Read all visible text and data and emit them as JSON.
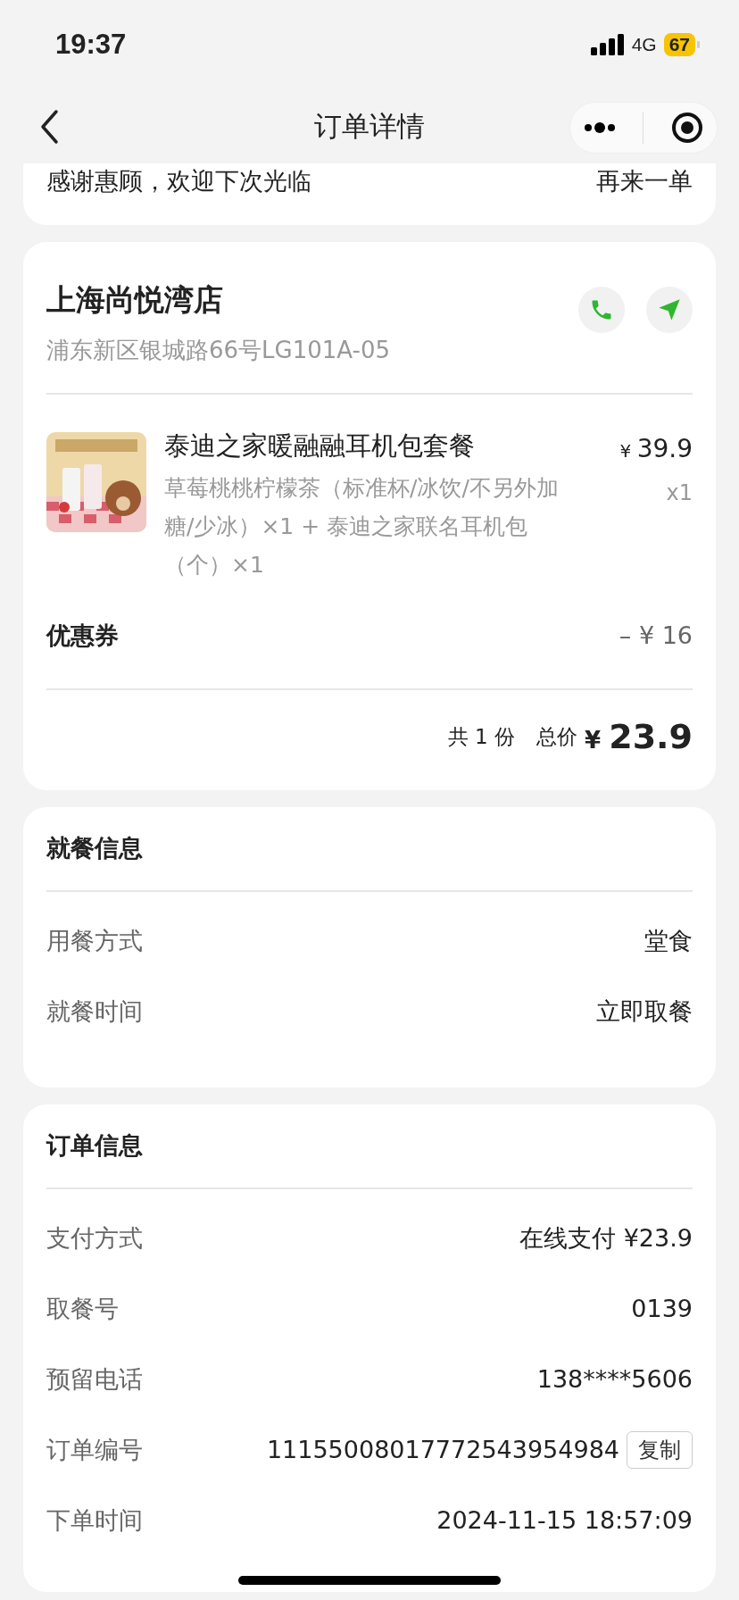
{
  "status_bar": {
    "time": "19:37",
    "network": "4G",
    "battery": "67"
  },
  "nav": {
    "title": "订单详情"
  },
  "notice": {
    "message": "感谢惠顾，欢迎下次光临",
    "action": "再来一单"
  },
  "store": {
    "name": "上海尚悦湾店",
    "address": "浦东新区银城路66号LG101A-05"
  },
  "product": {
    "kind": "picture",
    "name": "泰迪之家暖融融耳机包套餐",
    "description": "草莓桃桃柠檬茶（标准杯/冰饮/不另外加糖/少冰）×1 + 泰迪之家联名耳机包（个）×1",
    "currency": "¥",
    "price": "39.9",
    "quantity": "x1"
  },
  "coupon": {
    "label": "优惠券",
    "value": "– ¥ 16"
  },
  "total": {
    "count": "共 1 份",
    "label": "总价",
    "currency": "¥",
    "amount": "23.9"
  },
  "dining": {
    "title": "就餐信息",
    "rows": [
      {
        "label": "用餐方式",
        "value": "堂食"
      },
      {
        "label": "就餐时间",
        "value": "立即取餐"
      }
    ]
  },
  "order": {
    "title": "订单信息",
    "rows": [
      {
        "label": "支付方式",
        "value": "在线支付 ¥23.9"
      },
      {
        "label": "取餐号",
        "value": "0139"
      },
      {
        "label": "预留电话",
        "value": "138****5606"
      },
      {
        "label": "订单编号",
        "value": "11155008017772543954984",
        "action": "复制"
      },
      {
        "label": "下单时间",
        "value": "2024-11-15 18:57:09"
      }
    ]
  }
}
